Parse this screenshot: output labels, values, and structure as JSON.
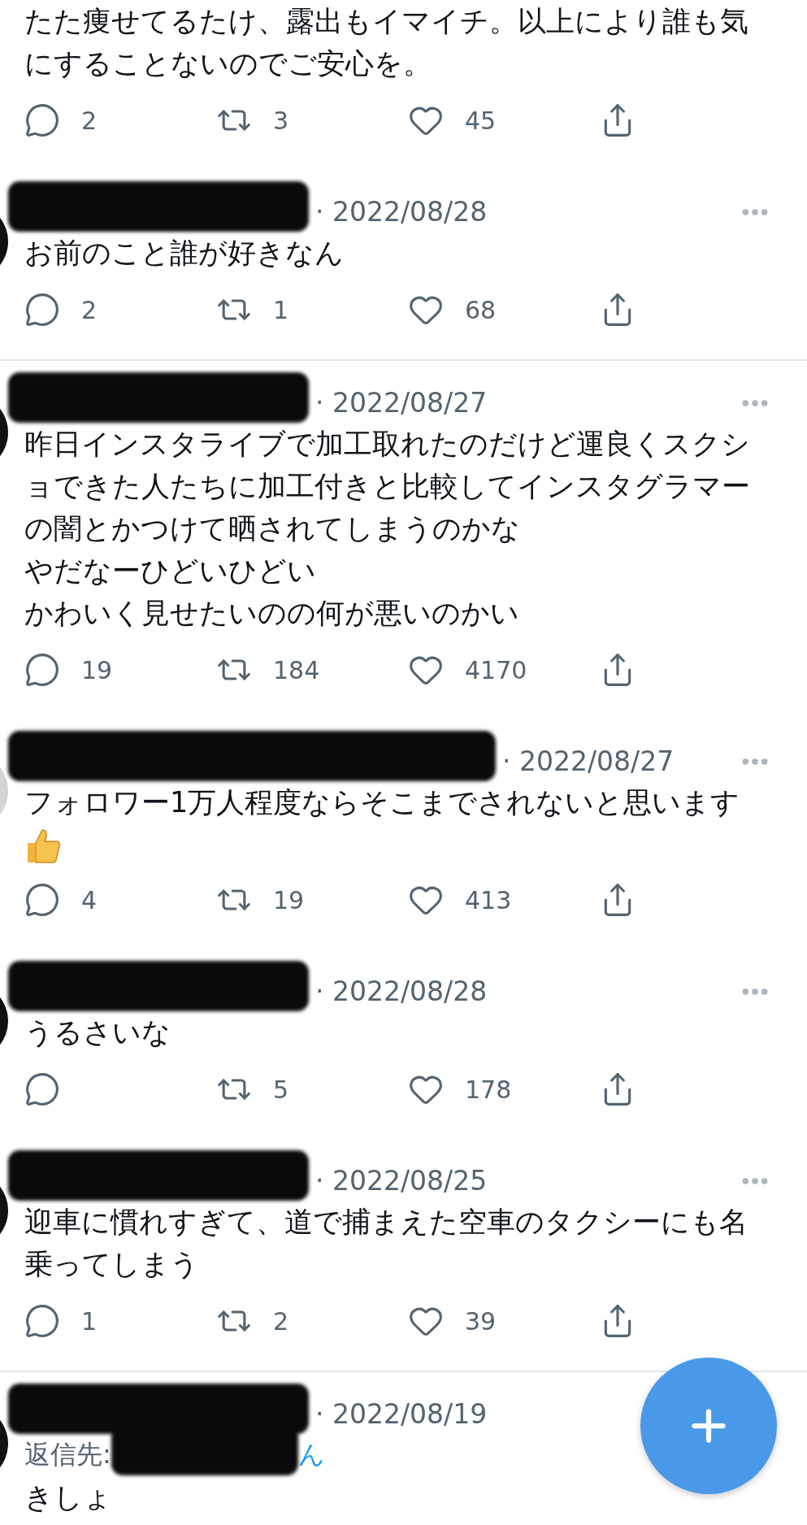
{
  "threads": [
    {
      "tweets": [
        {
          "lines": [
            "たた痩せてるたけ、露出もイマイチ。以上により誰も気",
            "にすることないのでご安心を。"
          ],
          "counts": {
            "replies": "2",
            "retweets": "3",
            "likes": "45"
          }
        },
        {
          "header": {
            "kind": "short",
            "date": "· 2022/08/28",
            "more_menu": true
          },
          "avatar": {
            "color": "#111111"
          },
          "lines": [
            "お前のこと誰が好きなん"
          ],
          "counts": {
            "replies": "2",
            "retweets": "1",
            "likes": "68"
          }
        }
      ]
    },
    {
      "tweets": [
        {
          "header": {
            "kind": "short",
            "date": "· 2022/08/27",
            "more_menu": true
          },
          "avatar": {
            "color": "#111111"
          },
          "lines": [
            "昨日インスタライブで加工取れたのだけど運良くスクシ",
            "ョできた人たちに加工付きと比較してインスタグラマー",
            "の闇とかつけて晒されてしまうのかな",
            "やだなーひどいひどい",
            "かわいく見せたいのの何が悪いのかい"
          ],
          "counts": {
            "replies": "19",
            "retweets": "184",
            "likes": "4170"
          }
        },
        {
          "header": {
            "kind": "long",
            "date": "· 2022/08/27",
            "more_menu": true
          },
          "avatar": {
            "color": "#d4d4d4"
          },
          "lines": [
            "フォロワー1万人程度ならそこまでされないと思います"
          ],
          "emoji": {
            "kind": "thumbs_up"
          },
          "counts": {
            "replies": "4",
            "retweets": "19",
            "likes": "413"
          }
        },
        {
          "header": {
            "kind": "short",
            "date": "· 2022/08/28",
            "more_menu": true
          },
          "avatar": {
            "color": "#111111"
          },
          "lines": [
            "うるさいな"
          ],
          "counts": {
            "retweets": "5",
            "likes": "178"
          }
        },
        {
          "header": {
            "kind": "short",
            "date": "· 2022/08/25",
            "more_menu": true
          },
          "avatar": {
            "color": "#111111"
          },
          "lines": [
            "迎車に慣れすぎて、道で捕まえた空車のタクシーにも名",
            "乗ってしまう"
          ],
          "counts": {
            "replies": "1",
            "retweets": "2",
            "likes": "39"
          }
        }
      ]
    },
    {
      "tweets": [
        {
          "header": {
            "kind": "short",
            "date": "· 2022/08/19"
          },
          "avatar": {
            "color": "#111111"
          },
          "reply_to": {
            "prefix": "返信先:",
            "suffix": "ん"
          },
          "lines": [
            "きしょ"
          ]
        }
      ]
    }
  ]
}
